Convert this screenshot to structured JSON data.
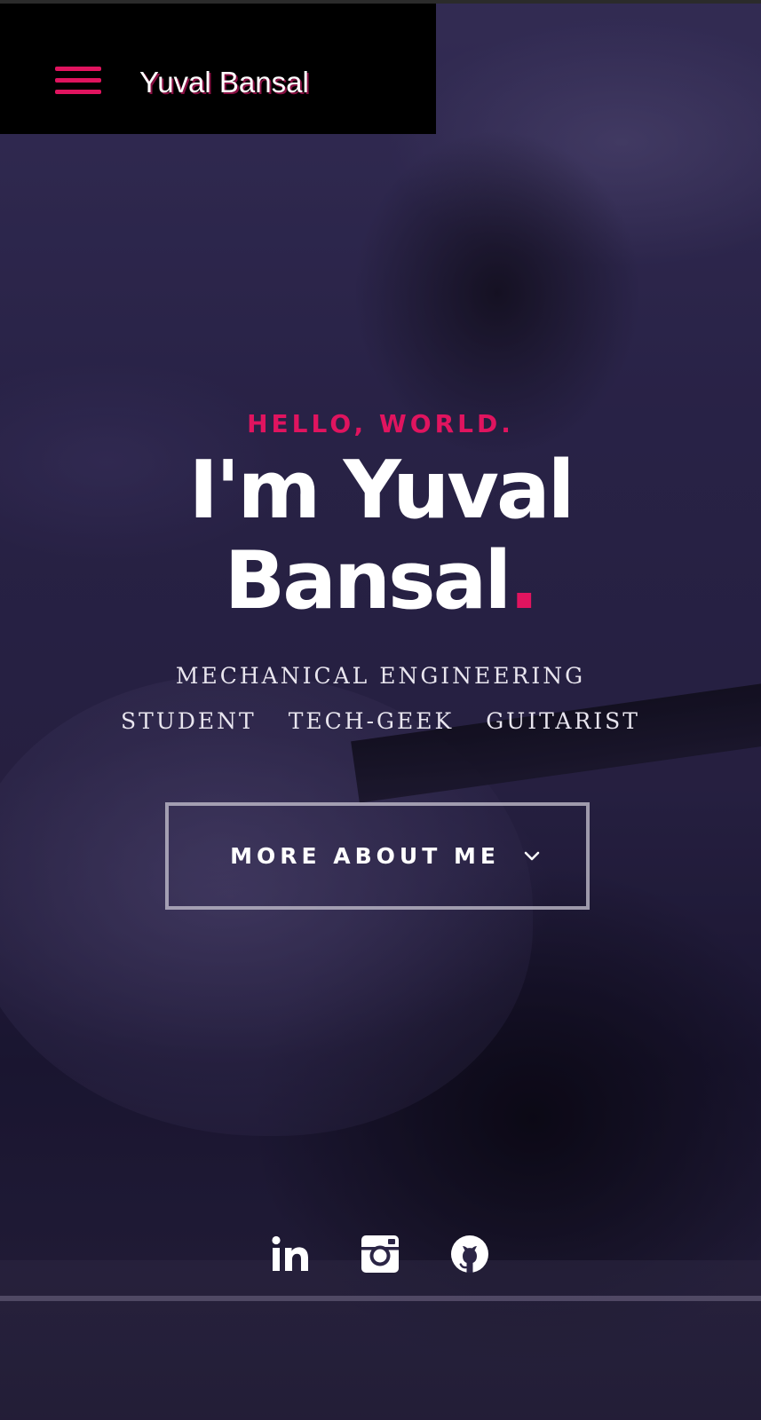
{
  "header": {
    "menu_icon": "hamburger-menu-icon",
    "site_name": "Yuval Bansal"
  },
  "hero": {
    "greeting": "HELLO, WORLD.",
    "headline_line1": "I'm Yuval",
    "headline_line2": "Bansal",
    "headline_period": ".",
    "roles": [
      "MECHANICAL ENGINEERING",
      "STUDENT",
      "TECH-GEEK",
      "GUITARIST"
    ]
  },
  "cta": {
    "label": "MORE ABOUT ME",
    "icon": "chevron-down-icon"
  },
  "social": [
    {
      "name": "linkedin",
      "icon": "linkedin-icon"
    },
    {
      "name": "instagram",
      "icon": "instagram-icon"
    },
    {
      "name": "github",
      "icon": "github-icon"
    }
  ],
  "colors": {
    "accent": "#e0145f",
    "header_bg": "#000000",
    "text": "#ffffff"
  }
}
